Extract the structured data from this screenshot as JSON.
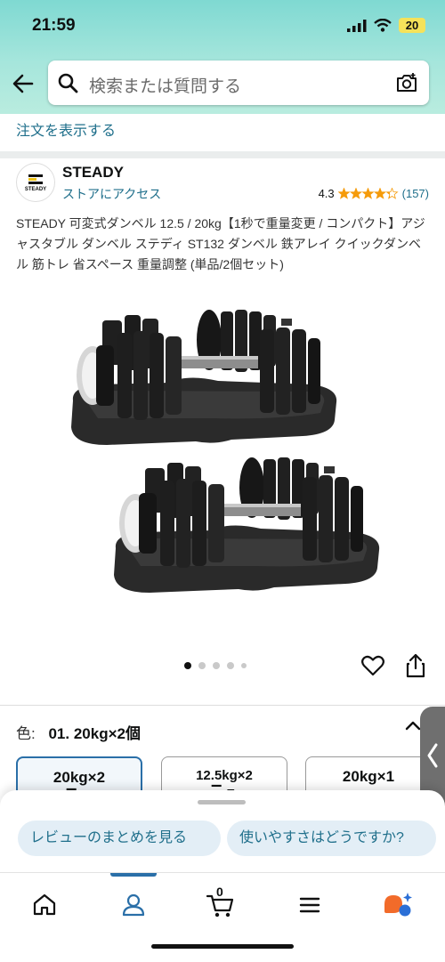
{
  "status_bar": {
    "time": "21:59",
    "battery": "20"
  },
  "search": {
    "placeholder": "検索または質問する"
  },
  "orders_link": "注文を表示する",
  "brand": {
    "logo_text": "STEADY",
    "name": "STEADY",
    "store_link": "ストアにアクセス"
  },
  "rating": {
    "value": "4.3",
    "stars": 4.3,
    "count": "(157)"
  },
  "product": {
    "title": "STEADY 可変式ダンベル 12.5 / 20kg【1秒で重量変更 / コンパクト】アジャスタブル ダンベル ステディ ST132 ダンベル 鉄アレイ クイックダンベル 筋トレ 省スペース 重量調整 (単品/2個セット)",
    "image_count": 5,
    "active_image_index": 0
  },
  "color": {
    "label": "色:",
    "value": "01. 20kg×2個"
  },
  "variants": [
    {
      "label": "20kg×2",
      "mark": "▔ ▼",
      "selected": true
    },
    {
      "label": "12.5kg×2",
      "mark": "▔ ▼",
      "selected": false
    },
    {
      "label": "20kg×1",
      "mark": "",
      "selected": false
    }
  ],
  "chips": [
    "レビューのまとめを見る",
    "使いやすさはどうですか?"
  ],
  "cart": {
    "count": "0"
  },
  "icons": {
    "back": "arrow-left-icon",
    "search": "search-icon",
    "camera": "camera-icon",
    "heart": "heart-icon",
    "share": "share-icon",
    "chevron": "chevron-up-icon",
    "home": "home-icon",
    "account": "account-icon",
    "cart": "cart-icon",
    "menu": "menu-icon",
    "assistant": "assistant-icon"
  },
  "colors": {
    "accent": "#2a6fa8",
    "link": "#1f6f8b",
    "star": "#f59b0b",
    "header": "#a6e6dc"
  }
}
